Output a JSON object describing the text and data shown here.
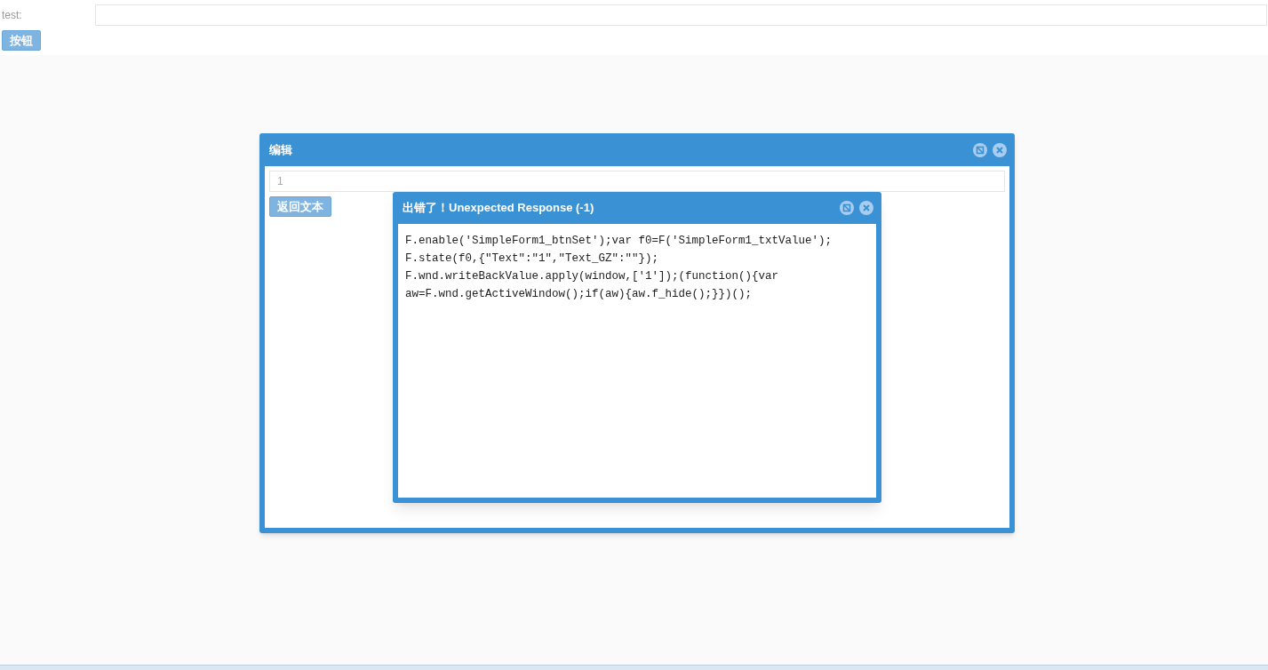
{
  "form": {
    "label": "test:",
    "button": "按钮"
  },
  "edit_window": {
    "title": "编辑",
    "field_value": "1",
    "button": "返回文本"
  },
  "error_window": {
    "title": "出错了！Unexpected Response (-1)",
    "message_lines": [
      "F.enable('SimpleForm1_btnSet');var f0=F('SimpleForm1_txtValue');",
      "F.state(f0,{\"Text\":\"1\",\"Text_GZ\":\"\"});",
      "F.wnd.writeBackValue.apply(window,['1']);(function(){var",
      "aw=F.wnd.getActiveWindow();if(aw){aw.f_hide();}})();"
    ]
  }
}
